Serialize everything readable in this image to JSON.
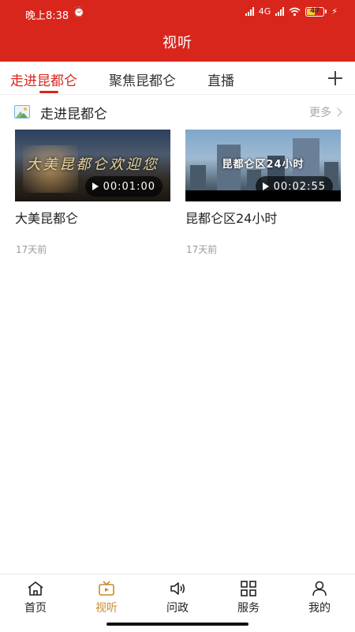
{
  "status_bar": {
    "time": "晚上8:38",
    "alarm_glyph": "⏰",
    "network": "4G",
    "battery_level": "47",
    "battery_fraction": 0.47
  },
  "header": {
    "title": "视听",
    "color": "#d9261c"
  },
  "tabs": [
    {
      "label": "走进昆都仑",
      "active": true
    },
    {
      "label": "聚焦昆都仑",
      "active": false
    },
    {
      "label": "直播",
      "active": false
    }
  ],
  "section": {
    "title": "走进昆都仑",
    "more_label": "更多"
  },
  "videos": [
    {
      "title": "大美昆都仑",
      "duration": "00:01:00",
      "posted": "17天前",
      "thumb_text": "大美昆都仑欢迎您"
    },
    {
      "title": "昆都仑区24小时",
      "duration": "00:02:55",
      "posted": "17天前",
      "thumb_text": "昆都仑区24小时"
    }
  ],
  "bottom_nav": [
    {
      "label": "首页",
      "icon": "home-icon",
      "active": false
    },
    {
      "label": "视听",
      "icon": "tv-icon",
      "active": true
    },
    {
      "label": "问政",
      "icon": "speaker-icon",
      "active": false
    },
    {
      "label": "服务",
      "icon": "grid-icon",
      "active": false
    },
    {
      "label": "我的",
      "icon": "person-icon",
      "active": false
    }
  ],
  "colors": {
    "accent": "#d9261c",
    "nav_active": "#c8892f",
    "muted_text": "#9a9a9a"
  }
}
